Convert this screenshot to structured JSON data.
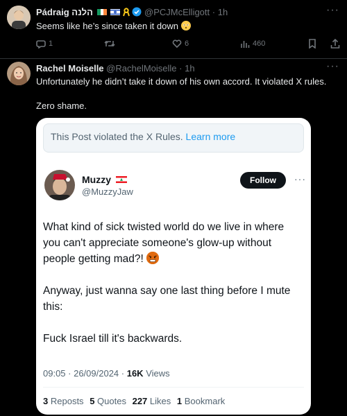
{
  "tweet1": {
    "name": "Pádraig הלנה",
    "handle": "@PCJMcElligott",
    "time": "1h",
    "text": "Seems like he’s since taken it down",
    "stats": {
      "replies": "1",
      "retweets": "",
      "likes": "6",
      "views": "460"
    }
  },
  "tweet2": {
    "name": "Rachel Moiselle",
    "handle": "@RachelMoiselle",
    "time": "1h",
    "line1": "Unfortunately he didn’t take it down of his own accord. It violated X rules.",
    "line2": "Zero shame."
  },
  "quote": {
    "violation_text": "This Post violated the X Rules.",
    "learn_more": "Learn more",
    "name": "Muzzy",
    "handle": "@MuzzyJaw",
    "follow_label": "Follow",
    "para1": "What kind of sick twisted world do we live in where you can't appreciate someone's glow-up without people getting mad?!",
    "para2": "Anyway, just wanna say one last thing before I mute this:",
    "para3": "Fuck Israel till it's backwards.",
    "timestamp": "09:05 · 26/09/2024 ·",
    "views_count": "16K",
    "views_label": "Views",
    "reposts_count": "3",
    "reposts_label": "Reposts",
    "quotes_count": "5",
    "quotes_label": "Quotes",
    "likes_count": "227",
    "likes_label": "Likes",
    "bookmarks_count": "1",
    "bookmarks_label": "Bookmark"
  },
  "colors": {
    "verified": "#1d9bf0",
    "link": "#1d9bf0",
    "background": "#000000"
  }
}
